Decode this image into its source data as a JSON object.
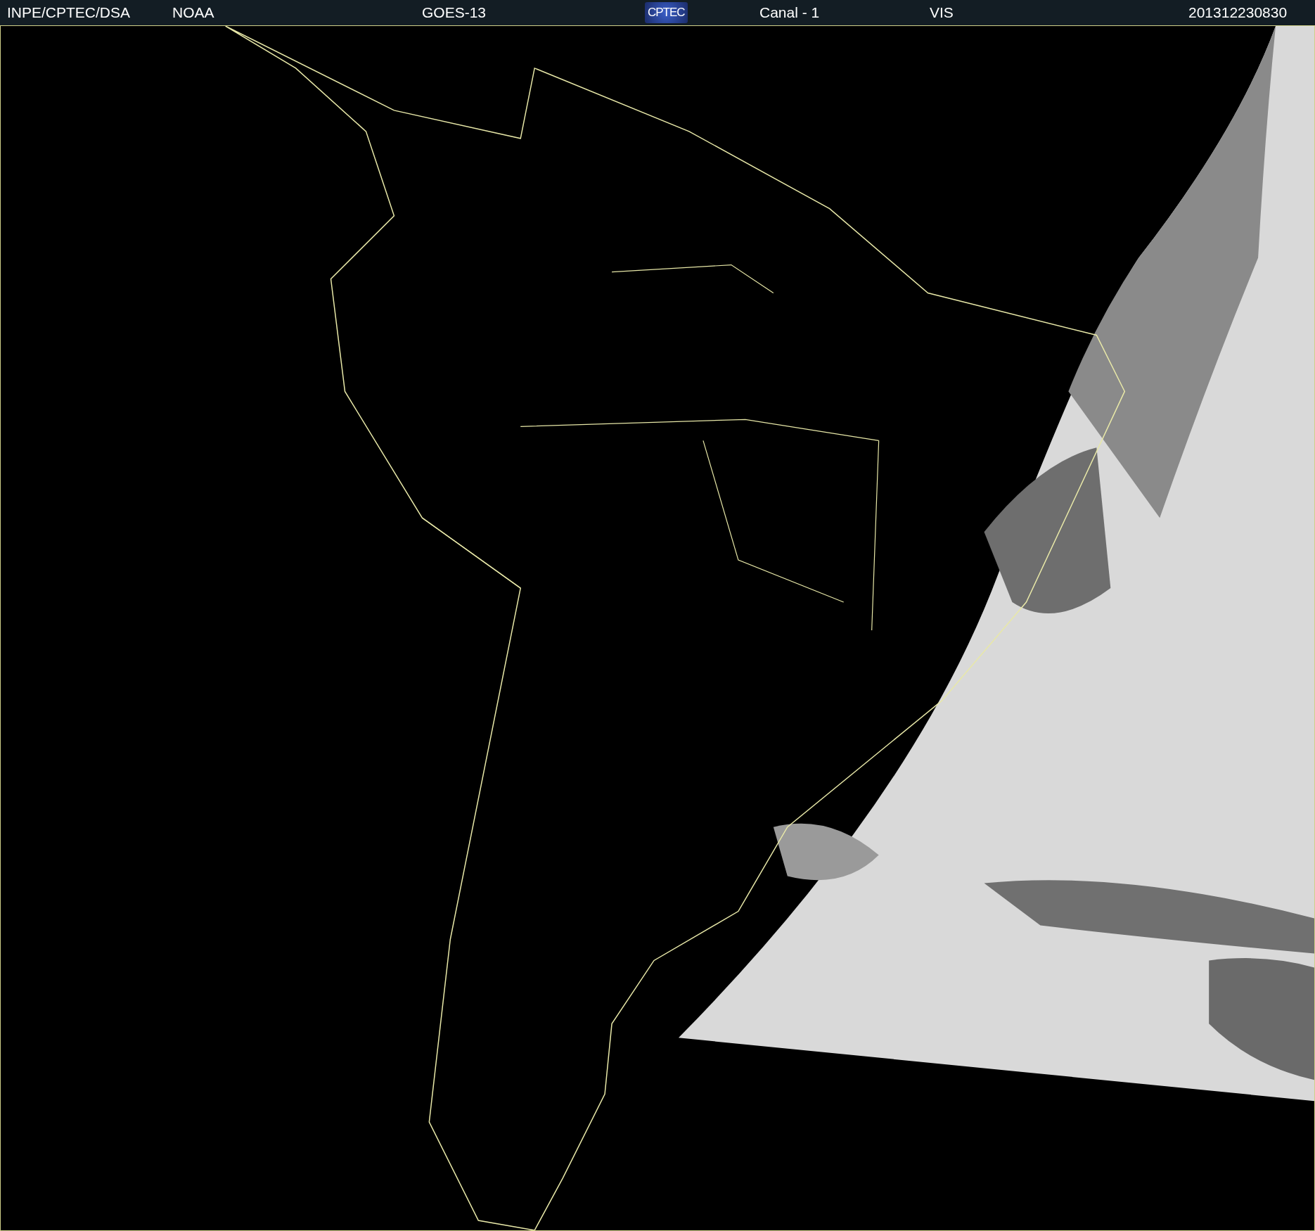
{
  "header": {
    "items": [
      {
        "kind": "text",
        "text": "INPE/CPTEC/DSA"
      },
      {
        "kind": "text",
        "text": "NOAA"
      },
      {
        "kind": "text",
        "text": "GOES-13"
      },
      {
        "kind": "logo",
        "text": "CPTEC"
      },
      {
        "kind": "text",
        "text": "Canal - 1"
      },
      {
        "kind": "text",
        "text": "VIS"
      },
      {
        "kind": "text",
        "text": "201312230830"
      }
    ]
  }
}
